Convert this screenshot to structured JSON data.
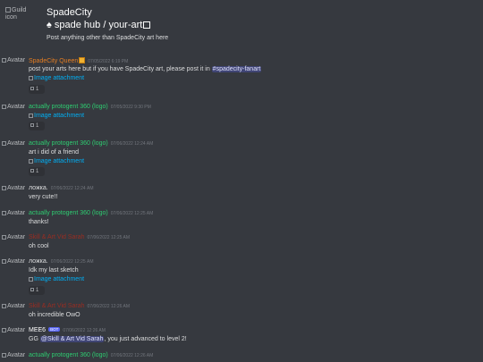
{
  "header": {
    "guild_icon_alt": "Guild icon",
    "guild_name": "SpadeCity",
    "channel_name": "♠ spade hub / your-art",
    "channel_topic": "Post anything other than SpadeCity art here"
  },
  "avatar_alt": "Avatar",
  "attachment_alt": "Image attachment",
  "messages": [
    {
      "author": "SpadeCity Queen",
      "author_color": "#e67e22",
      "timestamp": "07/05/2022 6:19 PM",
      "text_before": "post your arts here but if you have SpadeCity art, please post it in ",
      "channel_mention": "#spadecity-fanart",
      "attachment": "Image attachment",
      "reaction_count": "1"
    },
    {
      "author": "actually protogent 360 (logo)",
      "author_color": "#2ecc71",
      "timestamp": "07/05/2022 9:30 PM",
      "attachment": "Image attachment",
      "reaction_count": "1"
    },
    {
      "author": "actually protogent 360 (logo)",
      "author_color": "#2ecc71",
      "timestamp": "07/06/2022 12:24 AM",
      "text": "art i did of a friend",
      "attachment": "Image attachment",
      "reaction_count": "1"
    },
    {
      "author": "ложка.",
      "author_color": "#dcddde",
      "timestamp": "07/06/2022 12:24 AM",
      "text": "very cute!!"
    },
    {
      "author": "actually protogent 360 (logo)",
      "author_color": "#2ecc71",
      "timestamp": "07/06/2022 12:25 AM",
      "text": "thanks!"
    },
    {
      "author": "Skill & Art Vid Sarah",
      "author_color": "#992d22",
      "timestamp": "07/06/2022 12:25 AM",
      "text": "oh cool"
    },
    {
      "author": "ложка.",
      "author_color": "#dcddde",
      "timestamp": "07/06/2022 12:25 AM",
      "text": "Idk my last sketch",
      "attachment": "Image attachment",
      "reaction_count": "1"
    },
    {
      "author": "Skill & Art Vid Sarah",
      "author_color": "#992d22",
      "timestamp": "07/06/2022 12:26 AM",
      "text": "oh incredible OwO"
    },
    {
      "author": "MEE6",
      "author_color": "#ffffff",
      "bot_tag": "BOT",
      "timestamp": "07/06/2022 12:26 AM",
      "text_before": "GG ",
      "user_mention": "@Skill & Art Vid Sarah",
      "text_after": ", you just advanced to level 2!"
    },
    {
      "author": "actually protogent 360 (logo)",
      "author_color": "#2ecc71",
      "timestamp": "07/06/2022 12:26 AM"
    }
  ]
}
